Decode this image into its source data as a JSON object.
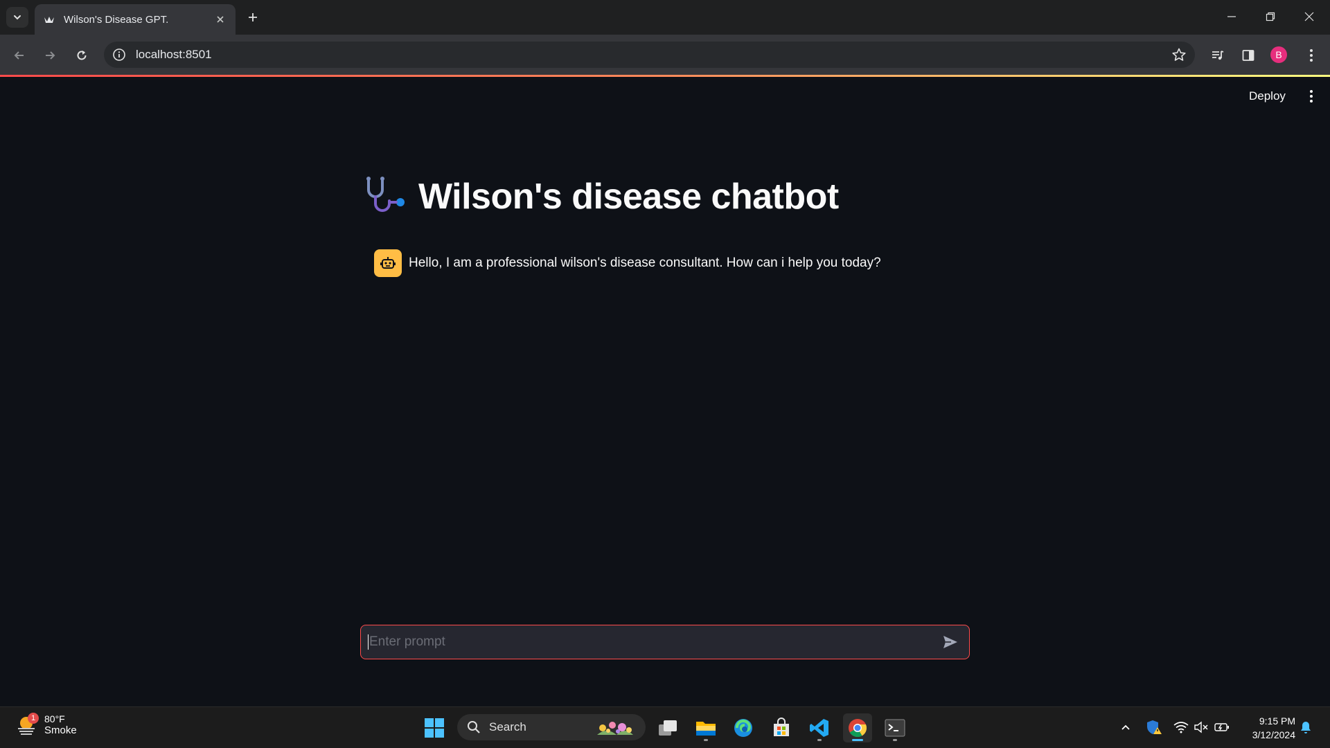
{
  "browser": {
    "tab_title": "Wilson's Disease GPT.",
    "url": "localhost:8501",
    "profile_initial": "B"
  },
  "streamlit": {
    "deploy_label": "Deploy",
    "app_title": "Wilson's disease chatbot",
    "assistant_message": "Hello, I am a professional wilson's disease consultant. How can i help you today?",
    "input_placeholder": "Enter prompt",
    "colors": {
      "background": "#0e1117",
      "primary": "#ff4b4b",
      "assistant_avatar": "#ffbd45",
      "input_bg": "#262730"
    }
  },
  "taskbar": {
    "weather_temp": "80°F",
    "weather_condition": "Smoke",
    "weather_badge": "1",
    "search_label": "Search",
    "time": "9:15 PM",
    "date": "3/12/2024",
    "pinned_apps": [
      "start-icon",
      "task-view-icon",
      "file-explorer-icon",
      "edge-icon",
      "store-icon",
      "vscode-icon",
      "chrome-icon",
      "terminal-icon"
    ]
  }
}
